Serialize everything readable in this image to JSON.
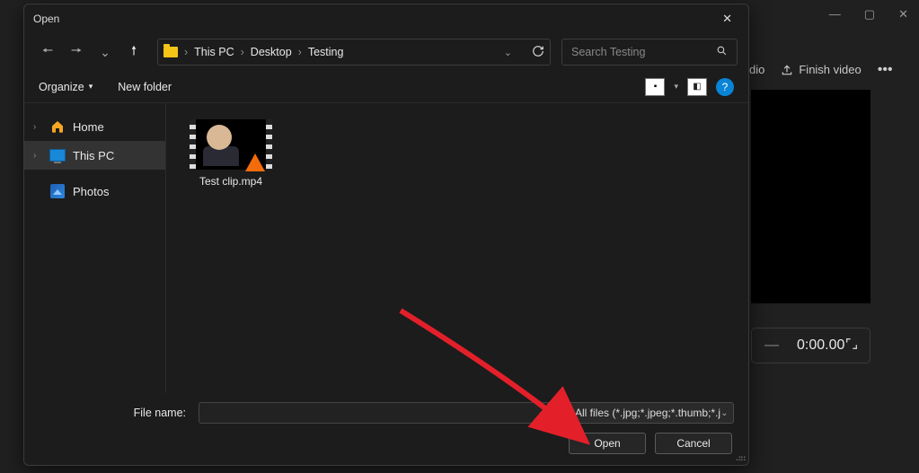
{
  "dialog": {
    "title": "Open",
    "breadcrumb": {
      "root": "This PC",
      "level1": "Desktop",
      "level2": "Testing"
    },
    "search_placeholder": "Search Testing",
    "organize": "Organize",
    "newfolder": "New folder",
    "sidebar": {
      "home": "Home",
      "thispc": "This PC",
      "photos": "Photos"
    },
    "file": {
      "name": "Test clip.mp4"
    },
    "filename_label": "File name:",
    "filter": "All files (*.jpg;*.jpeg;*.thumb;*.j",
    "open": "Open",
    "cancel": "Cancel"
  },
  "backdrop": {
    "audio": "dio",
    "finish": "Finish video",
    "time": "0:00.00"
  }
}
